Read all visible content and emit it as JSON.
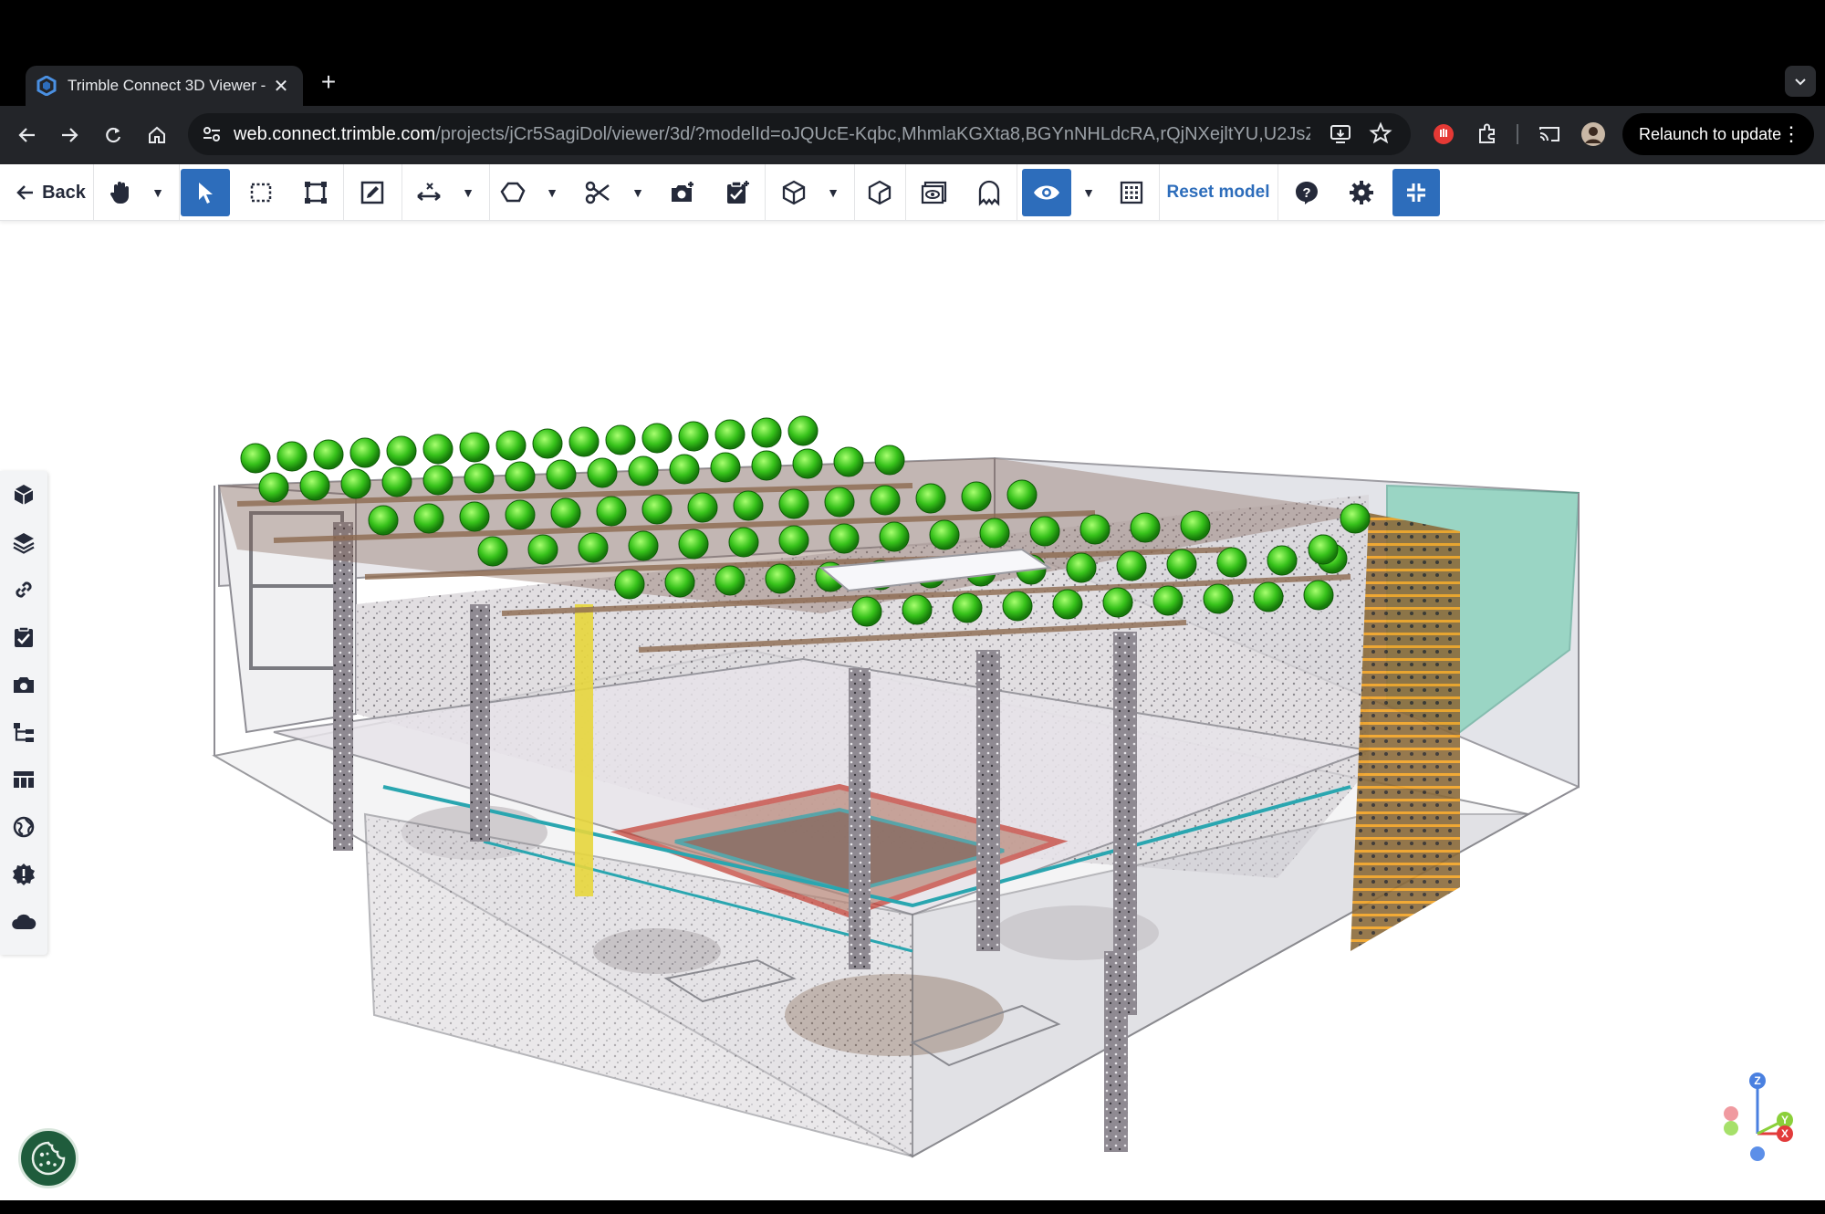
{
  "browser": {
    "tab_title": "Trimble Connect 3D Viewer -",
    "new_tab_label": "+",
    "url_host": "web.connect.trimble.com",
    "url_path": "/projects/jCr5SagiDol/viewer/3d/?modelId=oJQUcE-Kqbc,MhmlaKGXta8,BGYnNHLdcRA,rQjNXejltYU,U2JsZB...",
    "relaunch_label": "Relaunch to update"
  },
  "toolbar": {
    "back_label": "Back",
    "reset_label": "Reset model"
  },
  "axis_gizmo": {
    "z": "Z",
    "y": "Y",
    "x": "X"
  },
  "colors": {
    "accent": "#2d6dbb",
    "chrome_dark": "#232529",
    "panel": "#f3f4f6"
  }
}
